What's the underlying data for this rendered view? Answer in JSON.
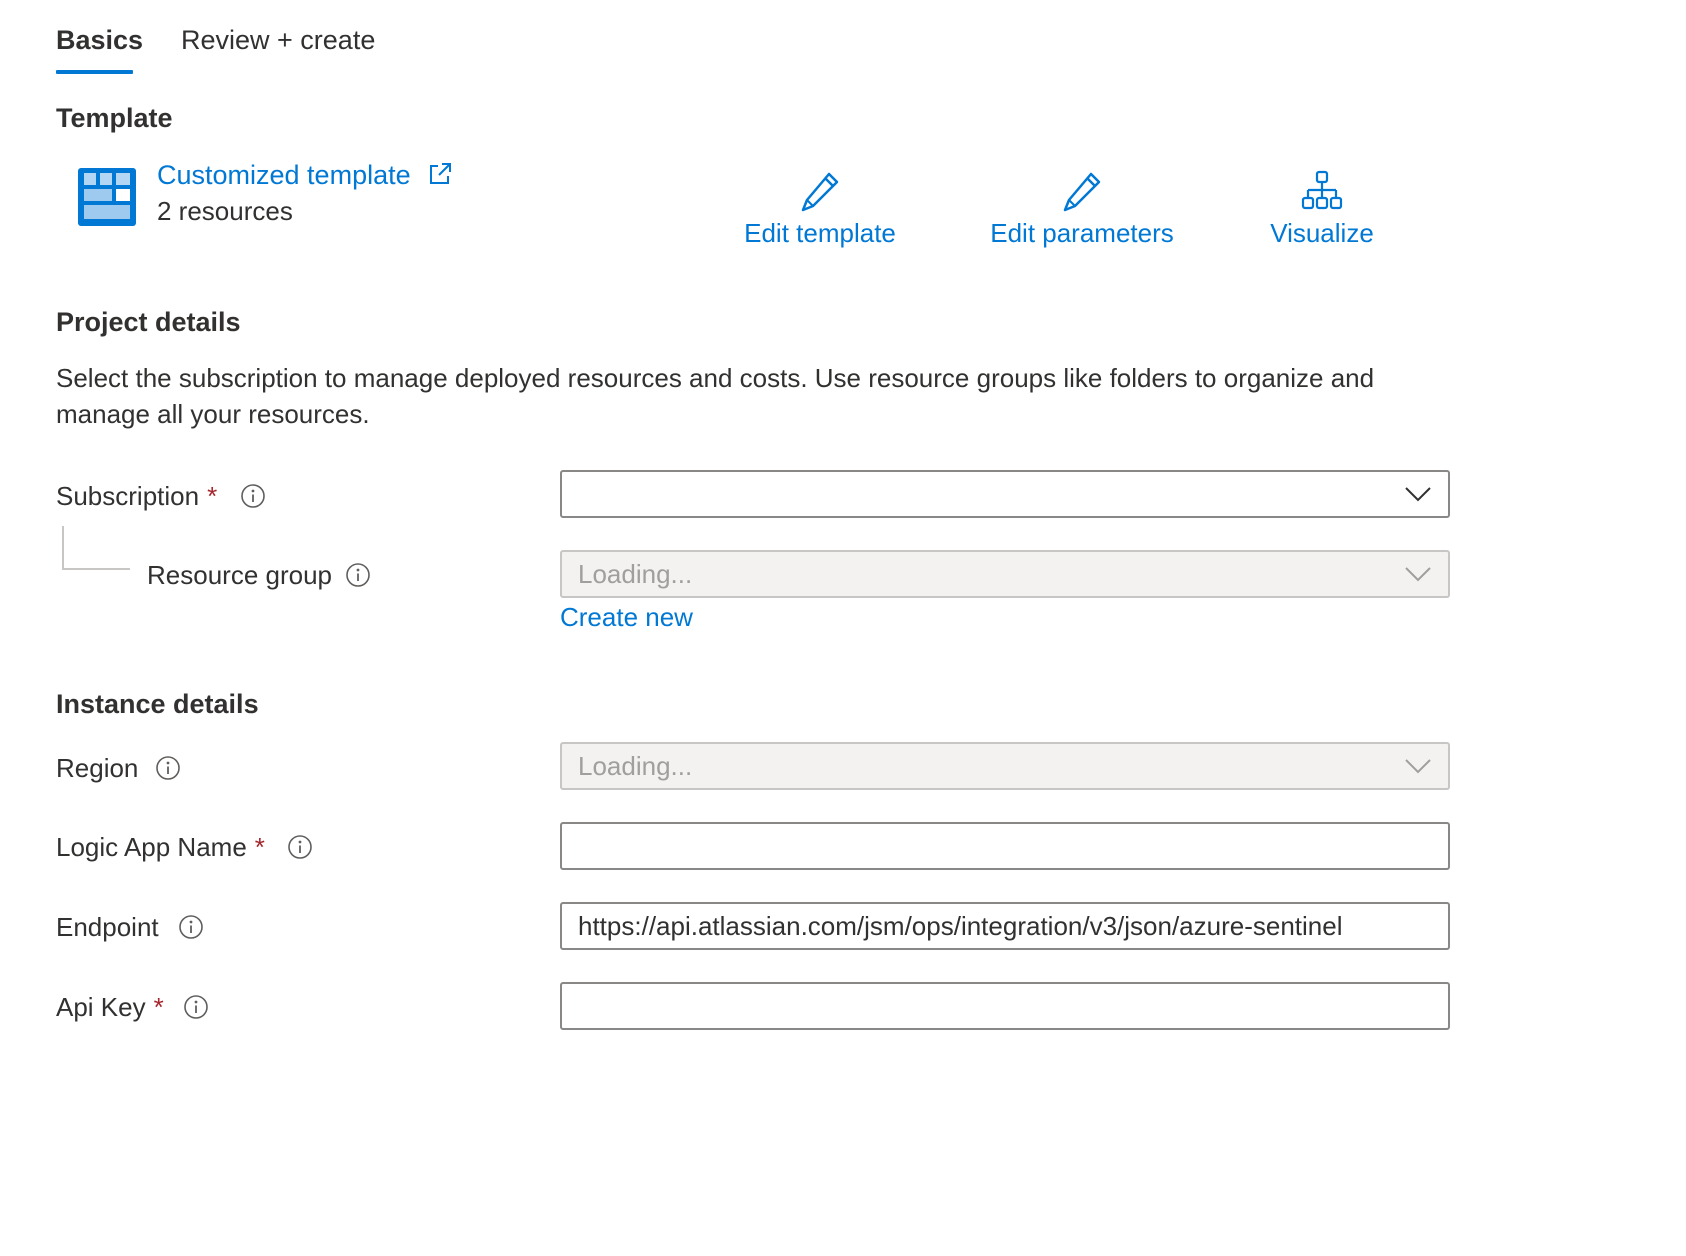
{
  "tabs": [
    {
      "label": "Basics",
      "active": true
    },
    {
      "label": "Review + create",
      "active": false
    }
  ],
  "template": {
    "section_title": "Template",
    "link_label": "Customized template",
    "resources_count": "2 resources",
    "actions": [
      {
        "label": "Edit template",
        "icon": "pencil-icon"
      },
      {
        "label": "Edit parameters",
        "icon": "pencil-icon"
      },
      {
        "label": "Visualize",
        "icon": "hierarchy-icon"
      }
    ]
  },
  "project": {
    "section_title": "Project details",
    "description": "Select the subscription to manage deployed resources and costs. Use resource groups like folders to organize and manage all your resources.",
    "subscription": {
      "label": "Subscription",
      "required": "*",
      "value": ""
    },
    "resource_group": {
      "label": "Resource group",
      "value": "Loading...",
      "create_new": "Create new"
    }
  },
  "instance": {
    "section_title": "Instance details",
    "region": {
      "label": "Region",
      "value": "Loading..."
    },
    "logic_app_name": {
      "label": "Logic App Name",
      "required": "*",
      "value": ""
    },
    "endpoint": {
      "label": "Endpoint",
      "value": "https://api.atlassian.com/jsm/ops/integration/v3/json/azure-sentinel"
    },
    "api_key": {
      "label": "Api Key",
      "required": "*",
      "value": ""
    }
  },
  "colors": {
    "accent": "#0078d4",
    "required": "#a4262c",
    "text": "#323130",
    "disabled_bg": "#f3f2f1"
  }
}
